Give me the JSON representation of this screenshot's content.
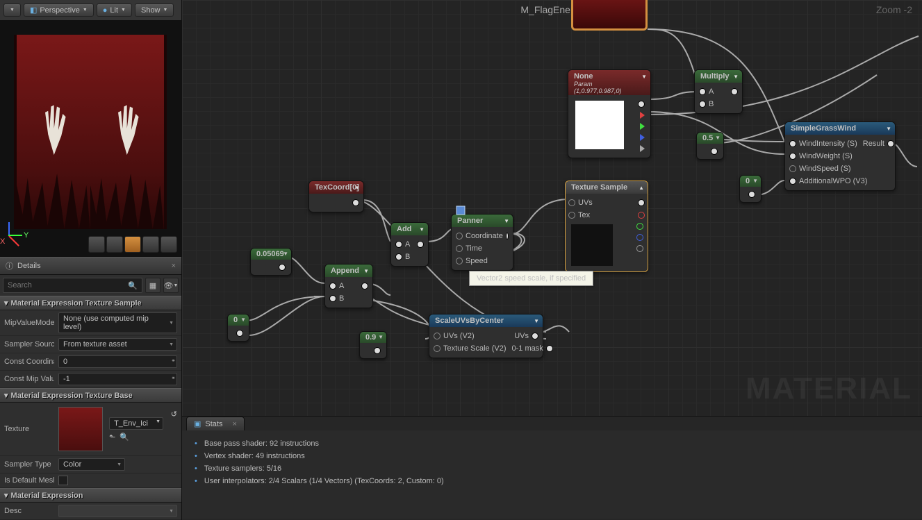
{
  "toolbar": {
    "perspective": "Perspective",
    "lit": "Lit",
    "show": "Show"
  },
  "axis": {
    "x": "X",
    "y": "Y"
  },
  "details": {
    "title": "Details",
    "search_placeholder": "Search",
    "section_texsample": "Material Expression Texture Sample",
    "mipvaluemode_label": "MipValueMode",
    "mipvaluemode_value": "None (use computed mip level)",
    "samplersource_label": "Sampler Source",
    "samplersource_value": "From texture asset",
    "constcoord_label": "Const Coordinate",
    "constcoord_value": "0",
    "constmip_label": "Const Mip Value",
    "constmip_value": "-1",
    "section_texbase": "Material Expression Texture Base",
    "texture_label": "Texture",
    "texture_value": "T_Env_Ici",
    "samplertype_label": "Sampler Type",
    "samplertype_value": "Color",
    "isdefault_label": "Is Default Mesh",
    "section_matexpr": "Material Expression",
    "desc_label": "Desc"
  },
  "graph": {
    "title": "M_FlagEnemy",
    "zoom": "Zoom -2",
    "watermark": "MATERIAL",
    "tooltip": "Vector2 speed scale, if specified"
  },
  "nodes": {
    "none_param": {
      "title": "None",
      "subtitle": "Param (1,0.977,0.987,0)"
    },
    "multiply": {
      "title": "Multiply",
      "a": "A",
      "b": "B"
    },
    "grasswind": {
      "title": "SimpleGrassWind",
      "in1": "WindIntensity (S)",
      "in2": "WindWeight (S)",
      "in3": "WindSpeed (S)",
      "in4": "AdditionalWPO (V3)",
      "out": "Result"
    },
    "const_05": "0.5",
    "const_0a": "0",
    "texsample": {
      "title": "Texture Sample",
      "uvs": "UVs",
      "tex": "Tex"
    },
    "texcoord": {
      "title": "TexCoord[0]"
    },
    "add": {
      "title": "Add",
      "a": "A",
      "b": "B"
    },
    "append": {
      "title": "Append",
      "a": "A",
      "b": "B"
    },
    "panner": {
      "title": "Panner",
      "coord": "Coordinate",
      "time": "Time",
      "speed": "Speed"
    },
    "const_005": "0.05069",
    "const_0b": "0",
    "const_09": "0.9",
    "scaleuv": {
      "title": "ScaleUVsByCenter",
      "uvs_in": "UVs (V2)",
      "scale_in": "Texture Scale (V2)",
      "uvs_out": "UVs",
      "mask_out": "0-1 mask"
    }
  },
  "stats": {
    "title": "Stats",
    "lines": [
      "Base pass shader: 92 instructions",
      "Vertex shader: 49 instructions",
      "Texture samplers: 5/16",
      "User interpolators: 2/4 Scalars (1/4 Vectors) (TexCoords: 2, Custom: 0)"
    ]
  }
}
